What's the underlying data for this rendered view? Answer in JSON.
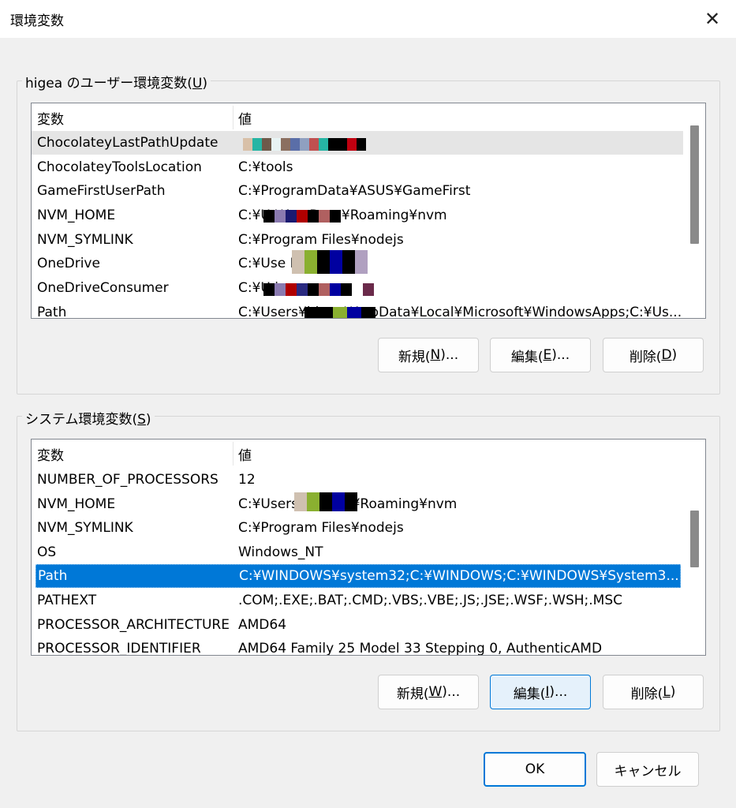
{
  "window": {
    "title": "環境変数",
    "close_glyph": "✕"
  },
  "user_section": {
    "label_prefix": "higea のユーザー環境変数(",
    "label_key": "U",
    "label_suffix": ")",
    "columns": [
      "変数",
      "値"
    ],
    "rows": [
      {
        "name": "ChocolateyLastPathUpdate",
        "value": ""
      },
      {
        "name": "ChocolateyToolsLocation",
        "value": "C:¥tools"
      },
      {
        "name": "GameFirstUserPath",
        "value": "C:¥ProgramData¥ASUS¥GameFirst"
      },
      {
        "name": "NVM_HOME",
        "value": "C:¥U          ¥AppData¥Roaming¥nvm"
      },
      {
        "name": "NVM_SYMLINK",
        "value": "C:¥Program Files¥nodejs"
      },
      {
        "name": "OneDrive",
        "value": "C:¥Use              Drive"
      },
      {
        "name": "OneDriveConsumer",
        "value": "C:¥U                       ive"
      },
      {
        "name": "Path",
        "value": "C:¥Users¥higea¥AppData¥Local¥Microsoft¥WindowsApps;C:¥Us..."
      }
    ],
    "buttons": {
      "new": {
        "text": "新規(",
        "key": "N",
        "tail": ")..."
      },
      "edit": {
        "text": "編集(",
        "key": "E",
        "tail": ")..."
      },
      "delete": {
        "text": "削除(",
        "key": "D",
        "tail": ")"
      }
    }
  },
  "system_section": {
    "label_prefix": "システム環境変数(",
    "label_key": "S",
    "label_suffix": ")",
    "columns": [
      "変数",
      "値"
    ],
    "rows": [
      {
        "name": "NUMBER_OF_PROCESSORS",
        "value": "12"
      },
      {
        "name": "NVM_HOME",
        "value": "C:¥Users         ppData¥Roaming¥nvm"
      },
      {
        "name": "NVM_SYMLINK",
        "value": "C:¥Program Files¥nodejs"
      },
      {
        "name": "OS",
        "value": "Windows_NT"
      },
      {
        "name": "Path",
        "value": "C:¥WINDOWS¥system32;C:¥WINDOWS;C:¥WINDOWS¥System3..."
      },
      {
        "name": "PATHEXT",
        "value": ".COM;.EXE;.BAT;.CMD;.VBS;.VBE;.JS;.JSE;.WSF;.WSH;.MSC"
      },
      {
        "name": "PROCESSOR_ARCHITECTURE",
        "value": "AMD64"
      },
      {
        "name": "PROCESSOR_IDENTIFIER",
        "value": "AMD64 Family 25 Model 33 Stepping 0, AuthenticAMD"
      }
    ],
    "buttons": {
      "new": {
        "text": "新規(",
        "key": "W",
        "tail": ")..."
      },
      "edit": {
        "text": "編集(",
        "key": "I",
        "tail": ")..."
      },
      "delete": {
        "text": "削除(",
        "key": "L",
        "tail": ")"
      }
    }
  },
  "footer": {
    "ok": "OK",
    "cancel": "キャンセル"
  },
  "colors": {
    "accent": "#0078d7",
    "dialog_bg": "#f0f0f0",
    "list_bg": "#ffffff",
    "hover_row": "#e5e5e5"
  }
}
